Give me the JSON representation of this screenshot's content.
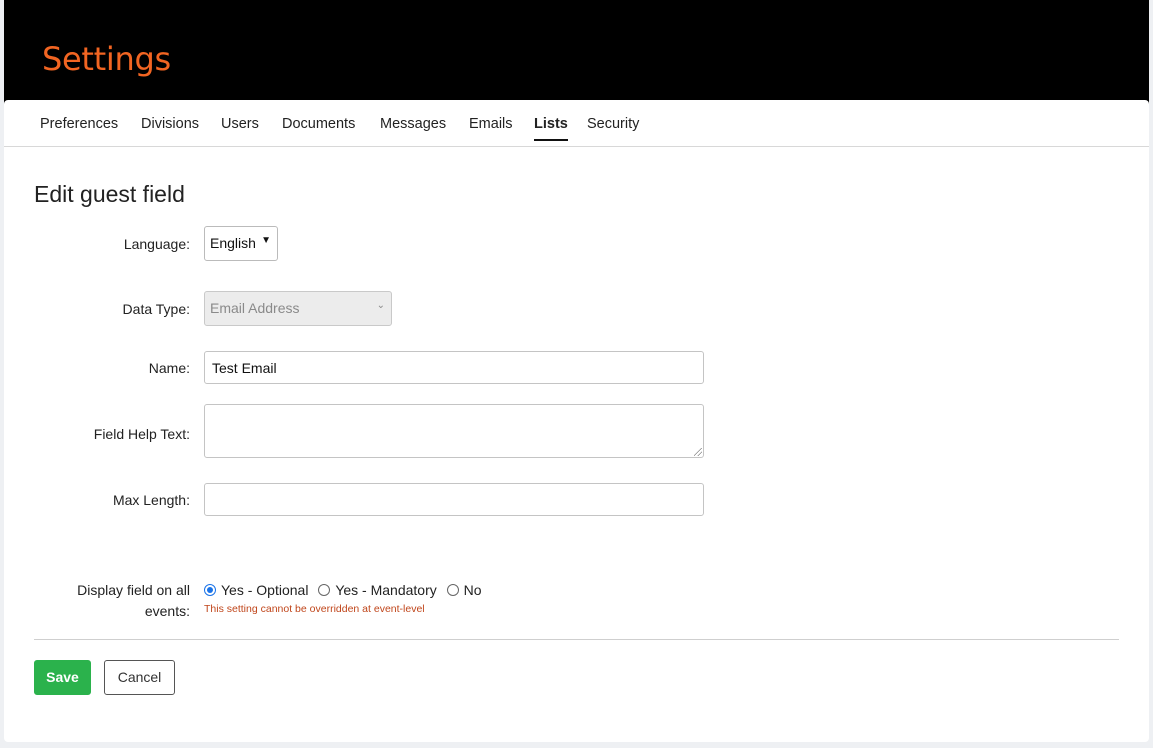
{
  "header": {
    "title": "Settings"
  },
  "tabs": [
    {
      "label": "Preferences"
    },
    {
      "label": "Divisions"
    },
    {
      "label": "Users"
    },
    {
      "label": "Documents"
    },
    {
      "label": "Messages"
    },
    {
      "label": "Emails"
    },
    {
      "label": "Lists",
      "active": true
    },
    {
      "label": "Security"
    }
  ],
  "form": {
    "title": "Edit guest field",
    "language": {
      "label": "Language:",
      "value": "English"
    },
    "data_type": {
      "label": "Data Type:",
      "value": "Email Address"
    },
    "name": {
      "label": "Name:",
      "value": "Test Email"
    },
    "help_text": {
      "label": "Field Help Text:",
      "value": ""
    },
    "max_length": {
      "label": "Max Length:",
      "value": ""
    },
    "display": {
      "label": "Display field on all events:",
      "options": [
        "Yes - Optional",
        "Yes - Mandatory",
        "No"
      ],
      "selected": "Yes - Optional",
      "note": "This setting cannot be overridden at event-level"
    }
  },
  "buttons": {
    "save": "Save",
    "cancel": "Cancel"
  },
  "colors": {
    "accent": "#f26522",
    "save": "#2bb24c",
    "radio": "#1a73e8",
    "note": "#c0461b"
  }
}
